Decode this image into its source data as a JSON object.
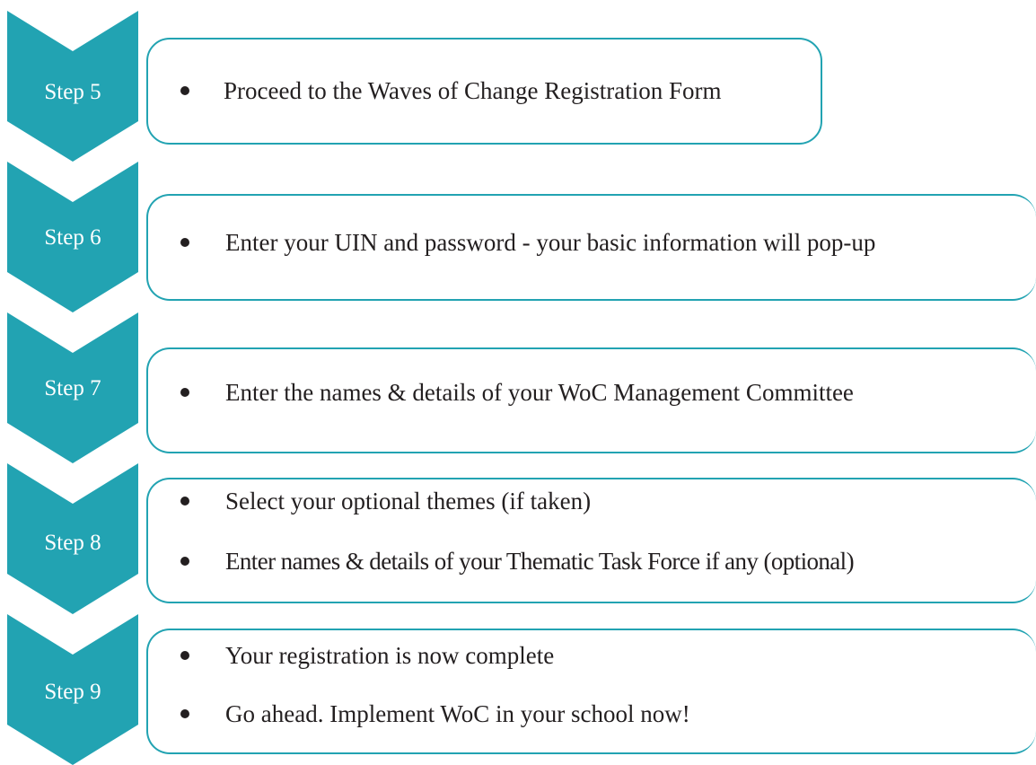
{
  "colors": {
    "accent": "#22a3b2",
    "text": "#231f20",
    "chevron_text": "#ffffff"
  },
  "steps": [
    {
      "label": "Step 5",
      "items": [
        "Proceed to the Waves of Change Registration Form"
      ]
    },
    {
      "label": "Step 6",
      "items": [
        "Enter your UIN and password -  your basic information will pop-up"
      ]
    },
    {
      "label": "Step 7",
      "items": [
        "Enter the names & details of your WoC Management Committee"
      ]
    },
    {
      "label": "Step 8",
      "items": [
        "Select your optional themes (if taken)",
        "Enter names & details of your Thematic Task Force if any (optional)"
      ]
    },
    {
      "label": "Step 9",
      "items": [
        "Your registration is now complete",
        "Go ahead. Implement WoC in your school now!"
      ]
    }
  ]
}
